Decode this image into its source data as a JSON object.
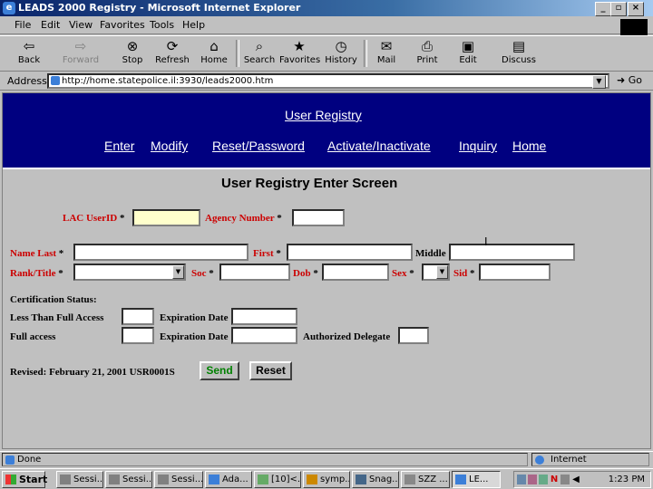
{
  "window": {
    "title": "LEADS 2000 Registry - Microsoft Internet Explorer"
  },
  "menu": [
    "File",
    "Edit",
    "View",
    "Favorites",
    "Tools",
    "Help"
  ],
  "toolbar": [
    {
      "label": "Back",
      "icon": "back-arrow-icon"
    },
    {
      "label": "Forward",
      "icon": "forward-arrow-icon"
    },
    {
      "label": "Stop",
      "icon": "stop-icon"
    },
    {
      "label": "Refresh",
      "icon": "refresh-icon"
    },
    {
      "label": "Home",
      "icon": "home-icon"
    },
    {
      "label": "Search",
      "icon": "search-icon"
    },
    {
      "label": "Favorites",
      "icon": "favorites-icon"
    },
    {
      "label": "History",
      "icon": "history-icon"
    },
    {
      "label": "Mail",
      "icon": "mail-icon"
    },
    {
      "label": "Print",
      "icon": "print-icon"
    },
    {
      "label": "Edit",
      "icon": "edit-icon"
    },
    {
      "label": "Discuss",
      "icon": "discuss-icon"
    }
  ],
  "address": {
    "label": "Address",
    "url": "http://home.statepolice.il:3930/leads2000.htm",
    "go": "Go"
  },
  "banner": {
    "title": "User Registry",
    "nav": [
      "Enter",
      "Modify",
      "Reset/Password",
      "Activate/Inactivate",
      "Inquiry",
      "Home"
    ]
  },
  "form": {
    "heading": "User  Registry Enter Screen",
    "lac_userid": "LAC UserID",
    "agency_number": "Agency Number",
    "name_last": "Name Last",
    "first": "First",
    "middle": "Middle",
    "rank_title": "Rank/Title",
    "soc": "Soc",
    "dob": "Dob",
    "sex": "Sex",
    "sid": "Sid",
    "req": "*",
    "cert_status": "Certification Status:",
    "less_than_full": "Less Than Full Access",
    "full_access": "Full access",
    "expiration_date": "Expiration Date",
    "authorized_delegate": "Authorized Delegate",
    "revised": "Revised: February 21,  2001   USR0001S",
    "send": "Send",
    "reset": "Reset"
  },
  "status": {
    "left": "Done",
    "zone": "Internet"
  },
  "taskbar": {
    "start": "Start",
    "items": [
      "Sessi...",
      "Sessi...",
      "Sessi...",
      "Ada...",
      "[10]<...",
      "symp...",
      "Snag...",
      "SZZ ...",
      "LE..."
    ],
    "clock": "1:23 PM"
  },
  "colors": {
    "banner": "#000080",
    "required_label": "#cc0000",
    "lac_field": "#ffffcc",
    "send_text": "#008000"
  }
}
